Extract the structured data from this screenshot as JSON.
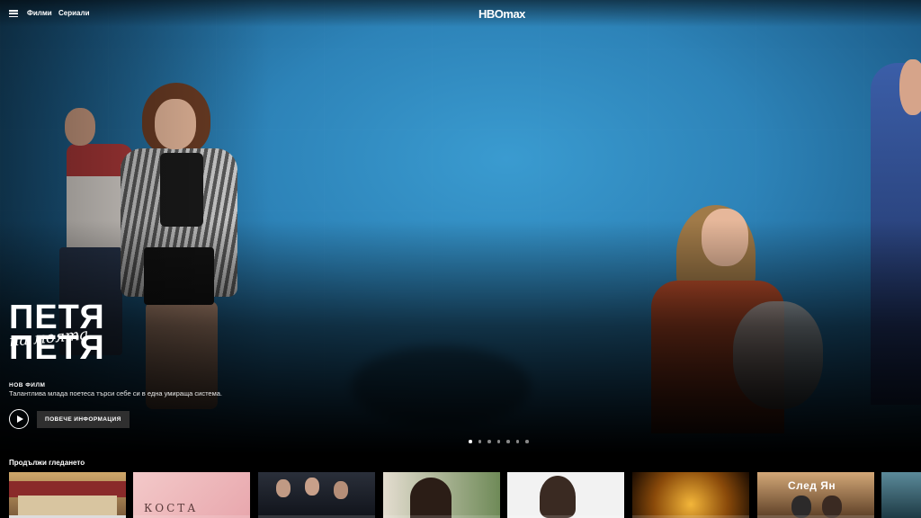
{
  "topbar": {
    "nav": [
      "Филми",
      "Сериали"
    ],
    "logo": "HBOmax"
  },
  "hero": {
    "title_line1": "ПЕТЯ",
    "title_script": "на моята",
    "title_line2": "ПЕТЯ",
    "badge": "НОВ ФИЛМ",
    "tagline": "Талантлива млада поетеса търси себе си в една умираща система.",
    "more_info_label": "ПОВЕЧЕ ИНФОРМАЦИЯ",
    "carousel_slides": 7,
    "carousel_active": 0
  },
  "continue_watching": {
    "title": "Продължи гледането",
    "cards": [
      {
        "text": "",
        "progress": 1.0
      },
      {
        "text": "КОСТА",
        "progress": 0.0
      },
      {
        "text": "",
        "progress": 0.0
      },
      {
        "text": "",
        "progress": 0.0
      },
      {
        "text": "",
        "progress": 0.0
      },
      {
        "text": "",
        "progress": 0.0
      },
      {
        "text": "След Ян",
        "progress": 0.0
      }
    ]
  },
  "colors": {
    "hero_blue": "#2d83b8",
    "button_gray": "#2f2f2f"
  }
}
